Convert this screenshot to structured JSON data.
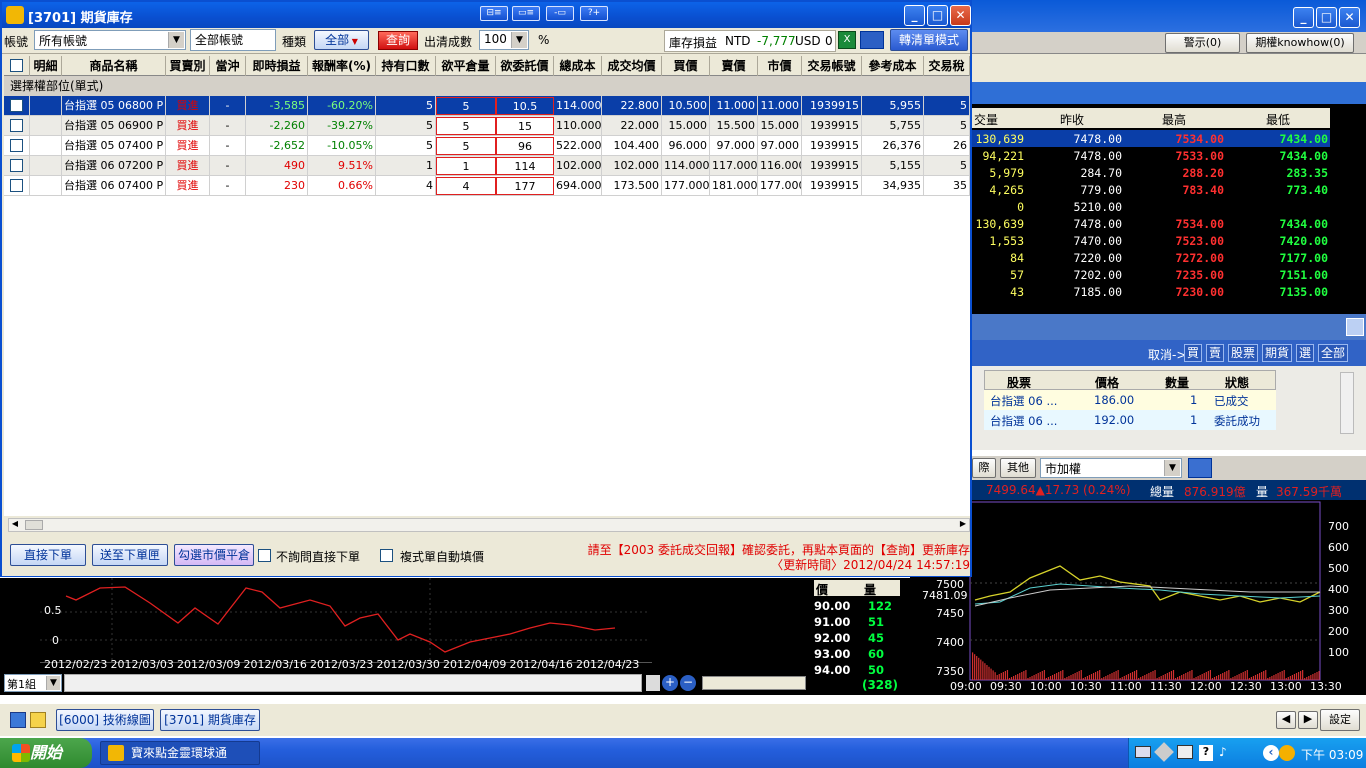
{
  "window": {
    "title": "[3701] 期貨庫存"
  },
  "title_icons": [
    "⊟≡",
    "▭≡",
    "-▭",
    "?+"
  ],
  "filter": {
    "account_label": "帳號",
    "account_value": "所有帳號",
    "account_text": "全部帳號",
    "category_label": "種類",
    "category_value": "全部",
    "query_button": "查詢",
    "clear_label": "出清成數",
    "clear_value": "100",
    "percent": "%",
    "pnl_label": "庫存損益",
    "ntd_label": "NTD",
    "ntd_value": "-7,777",
    "usd_label": "USD",
    "usd_value": "0",
    "switch_button": "轉清單模式"
  },
  "grid": {
    "headers": [
      "明細",
      "商品名稱",
      "買賣別",
      "當沖",
      "即時損益",
      "報酬率(%)",
      "持有口數",
      "欲平倉量",
      "欲委託價",
      "總成本",
      "成交均價",
      "買價",
      "賣價",
      "市價",
      "交易帳號",
      "參考成本",
      "交易稅"
    ],
    "group_label": "選擇權部位(單式)",
    "rows": [
      {
        "name": "台指選 05 06800 P",
        "side": "買進",
        "dc": "-",
        "pnl": "-3,585",
        "ret": "-60.20%",
        "qty": "5",
        "close_qty": "5",
        "order_px": "10.5",
        "total_cost": "114.000",
        "avg": "22.800",
        "bid": "10.500",
        "ask": "11.000",
        "mkt": "11.000",
        "acct": "1939915",
        "ref": "5,955",
        "tax": "5"
      },
      {
        "name": "台指選 05 06900 P",
        "side": "買進",
        "dc": "-",
        "pnl": "-2,260",
        "ret": "-39.27%",
        "qty": "5",
        "close_qty": "5",
        "order_px": "15",
        "total_cost": "110.000",
        "avg": "22.000",
        "bid": "15.000",
        "ask": "15.500",
        "mkt": "15.000",
        "acct": "1939915",
        "ref": "5,755",
        "tax": "5"
      },
      {
        "name": "台指選 05 07400 P",
        "side": "買進",
        "dc": "-",
        "pnl": "-2,652",
        "ret": "-10.05%",
        "qty": "5",
        "close_qty": "5",
        "order_px": "96",
        "total_cost": "522.000",
        "avg": "104.400",
        "bid": "96.000",
        "ask": "97.000",
        "mkt": "97.000",
        "acct": "1939915",
        "ref": "26,376",
        "tax": "26"
      },
      {
        "name": "台指選 06 07200 P",
        "side": "買進",
        "dc": "-",
        "pnl": "490",
        "ret": "9.51%",
        "qty": "1",
        "close_qty": "1",
        "order_px": "114",
        "total_cost": "102.000",
        "avg": "102.000",
        "bid": "114.000",
        "ask": "117.000",
        "mkt": "116.000",
        "acct": "1939915",
        "ref": "5,155",
        "tax": "5"
      },
      {
        "name": "台指選 06 07400 P",
        "side": "買進",
        "dc": "-",
        "pnl": "230",
        "ret": "0.66%",
        "qty": "4",
        "close_qty": "4",
        "order_px": "177",
        "total_cost": "694.000",
        "avg": "173.500",
        "bid": "177.000",
        "ask": "181.000",
        "mkt": "177.000",
        "acct": "1939915",
        "ref": "34,935",
        "tax": "35"
      }
    ]
  },
  "bottom": {
    "direct_order": "直接下單",
    "send_to_order": "送至下單匣",
    "check_market_close": "勾選市價平倉",
    "no_ask_label": "不詢問直接下單",
    "auto_fill_label": "複式單自動填價",
    "notice": "請至【2003 委託成交回報】確認委託，再點本頁面的【查詢】更新庫存",
    "update_time": "〈更新時間〉2012/04/24 14:57:19"
  },
  "bg": {
    "alert_button": "警示(0)",
    "knowhow_button": "期權knowhow(0)",
    "quote_headers": [
      "交量",
      "昨收",
      "最高",
      "最低"
    ],
    "quotes": [
      [
        "130,639",
        "7478.00",
        "7534.00",
        "7434.00"
      ],
      [
        "94,221",
        "7478.00",
        "7533.00",
        "7434.00"
      ],
      [
        "5,979",
        "284.70",
        "288.20",
        "283.35"
      ],
      [
        "4,265",
        "779.00",
        "783.40",
        "773.40"
      ],
      [
        "0",
        "5210.00",
        "",
        ""
      ],
      [
        "130,639",
        "7478.00",
        "7534.00",
        "7434.00"
      ],
      [
        "1,553",
        "7470.00",
        "7523.00",
        "7420.00"
      ],
      [
        "84",
        "7220.00",
        "7272.00",
        "7177.00"
      ],
      [
        "57",
        "7202.00",
        "7235.00",
        "7151.00"
      ],
      [
        "43",
        "7185.00",
        "7230.00",
        "7135.00"
      ]
    ],
    "cancel_label": "取消->",
    "cancel_buttons": [
      "買",
      "賣",
      "股票",
      "期貨",
      "選",
      "全部"
    ],
    "orders_headers": [
      "股票",
      "價格",
      "數量",
      "狀態"
    ],
    "orders": [
      [
        "台指選 06 ...",
        "186.00",
        "1",
        "已成交"
      ],
      [
        "台指選 06 ...",
        "192.00",
        "1",
        "委託成功"
      ]
    ],
    "chart_tabs": [
      "際",
      "其他"
    ],
    "chart_select": "市加權",
    "status_index": "7499.64▲17.73 (0.24%)",
    "status_total_label": "總量",
    "status_total": "876.919億",
    "status_vol_label": "量",
    "status_vol": "367.59千萬",
    "chart_price_ticks": [
      "7500",
      "7450",
      "7400",
      "7350"
    ],
    "chart_cursor_price": "7481.09",
    "chart_vol_ticks": [
      "700",
      "600",
      "500",
      "400",
      "300",
      "200",
      "100"
    ],
    "chart_time_ticks": [
      "09:00",
      "09:30",
      "10:00",
      "10:30",
      "11:00",
      "11:30",
      "12:00",
      "12:30",
      "13:00",
      "13:30"
    ],
    "left_chart_dates": [
      "2012/02/23",
      "2012/03/03",
      "2012/03/09",
      "2012/03/16",
      "2012/03/23",
      "2012/03/30",
      "2012/04/09",
      "2012/04/16",
      "2012/04/23"
    ],
    "left_chart_ticks": [
      "0.5",
      "0"
    ],
    "group_select": "第1組",
    "book_header": [
      "價",
      "量"
    ],
    "book": [
      [
        "90.00",
        "122"
      ],
      [
        "91.00",
        "51"
      ],
      [
        "92.00",
        "45"
      ],
      [
        "93.00",
        "60"
      ],
      [
        "94.00",
        "50"
      ]
    ],
    "book_total": "(328)"
  },
  "taskbar": {
    "tab1": "[6000] 技術線圖",
    "tab2": "[3701] 期貨庫存",
    "settings": "設定",
    "start": "開始",
    "app": "寶來點金靈環球通",
    "clock": "下午 03:09"
  },
  "colors": {
    "red": "#e00000",
    "green": "#008000",
    "select_blue": "#0a3ea8"
  }
}
